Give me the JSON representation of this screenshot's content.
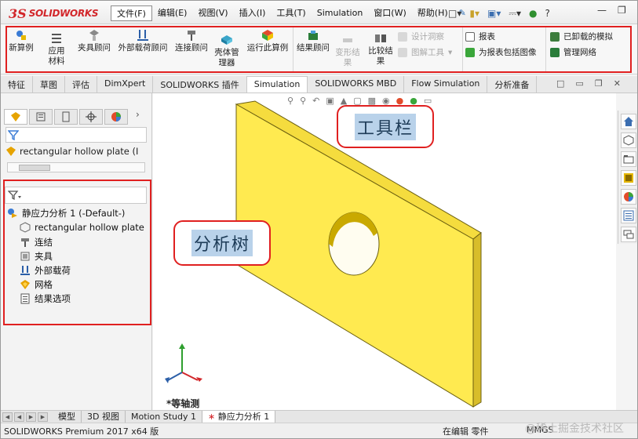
{
  "app": {
    "logo_mark": "3S",
    "logo_text": "SOLIDWORKS"
  },
  "menu": [
    "文件(F)",
    "编辑(E)",
    "视图(V)",
    "插入(I)",
    "工具(T)",
    "Simulation",
    "窗口(W)",
    "帮助(H)"
  ],
  "quick_access": {
    "help": "?"
  },
  "ribbon": {
    "new_study": "新算例",
    "apply_material": "应用材料",
    "fixtures_advisor": "夹具顾问",
    "external_loads_advisor": "外部载荷顾问",
    "connections_advisor": "连接顾问",
    "shell_manager": "壳体管理器",
    "run_study": "运行此算例",
    "results_advisor": "结果顾问",
    "deformed_result": "变形结果",
    "compare_results": "比较结果",
    "design_insight": "设计洞察",
    "plot_tools": "图解工具",
    "report": "报表",
    "include_image": "为报表包括图像",
    "unloaded_sims": "已卸载的模拟",
    "manage_network": "管理网络"
  },
  "tabs": [
    "特征",
    "草图",
    "评估",
    "DimXpert",
    "SOLIDWORKS 插件",
    "Simulation",
    "SOLIDWORKS MBD",
    "Flow Simulation",
    "分析准备"
  ],
  "active_tab": "Simulation",
  "feature_manager": {
    "part_name": "rectangular hollow plate  (I"
  },
  "analysis_tree": {
    "study": "静应力分析 1 (-Default-)",
    "items": [
      "rectangular hollow plate",
      "连结",
      "夹具",
      "外部载荷",
      "网格",
      "结果选项"
    ]
  },
  "callouts": {
    "toolbar": "工具栏",
    "tree": "分析树"
  },
  "viewport": {
    "view_label": "*等轴测",
    "part_color": "#ffea50"
  },
  "bottom_tabs": [
    "模型",
    "3D 视图",
    "Motion Study 1",
    "静应力分析 1"
  ],
  "status": {
    "left": "SOLIDWORKS Premium 2017 x64 版",
    "mode": "在编辑 零件",
    "units": "MMGS"
  },
  "watermark": "@稀土掘金技术社区"
}
